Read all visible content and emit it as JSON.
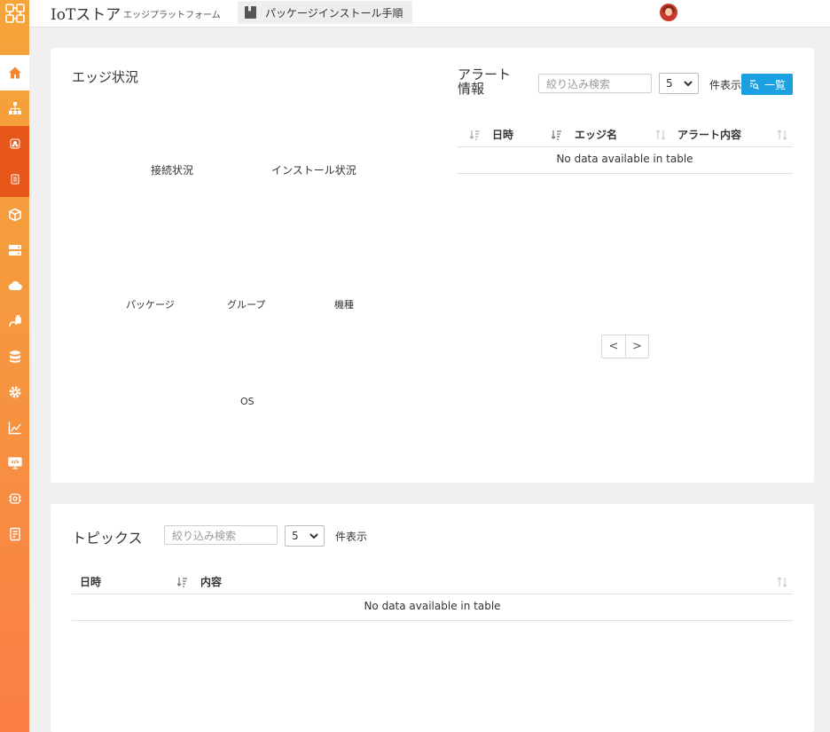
{
  "header": {
    "app_title": "IoTストア",
    "app_subtitle": "エッジプラットフォーム",
    "install_guide_label": "パッケージインストール手順"
  },
  "sidebar": {
    "icons": [
      "logo-icon",
      "home-icon",
      "network-icon",
      "sub-app-icon",
      "sub-doc-icon",
      "package-icon",
      "server-icon",
      "cloud-icon",
      "plugin-icon",
      "database-icon",
      "gear-icon",
      "chart-icon",
      "monitor-code-icon",
      "device-icon",
      "document-icon"
    ]
  },
  "edge_status": {
    "title": "エッジ状況",
    "labels": {
      "connection": "接続状況",
      "install": "インストール状況",
      "package": "パッケージ",
      "group": "グループ",
      "model": "機種",
      "os": "OS"
    }
  },
  "alert": {
    "title_line1": "アラート",
    "title_line2": "情報",
    "search_placeholder": "絞り込み検索",
    "page_size": "5",
    "page_size_suffix": "件表示",
    "list_button": "一覧",
    "columns": [
      "日時",
      "エッジ名",
      "アラート内容"
    ],
    "empty_message": "No data available in table",
    "pager_prev": "<",
    "pager_next": ">"
  },
  "topics": {
    "title": "トピックス",
    "search_placeholder": "絞り込み検索",
    "page_size": "5",
    "page_size_suffix": "件表示",
    "columns": [
      "日時",
      "内容"
    ],
    "empty_message": "No data available in table"
  },
  "colors": {
    "sidebar_top": "#f6a43a",
    "sidebar_bottom": "#fb7d45",
    "sidebar_sub": "#e7571a",
    "accent_button": "#1ba0e2"
  }
}
